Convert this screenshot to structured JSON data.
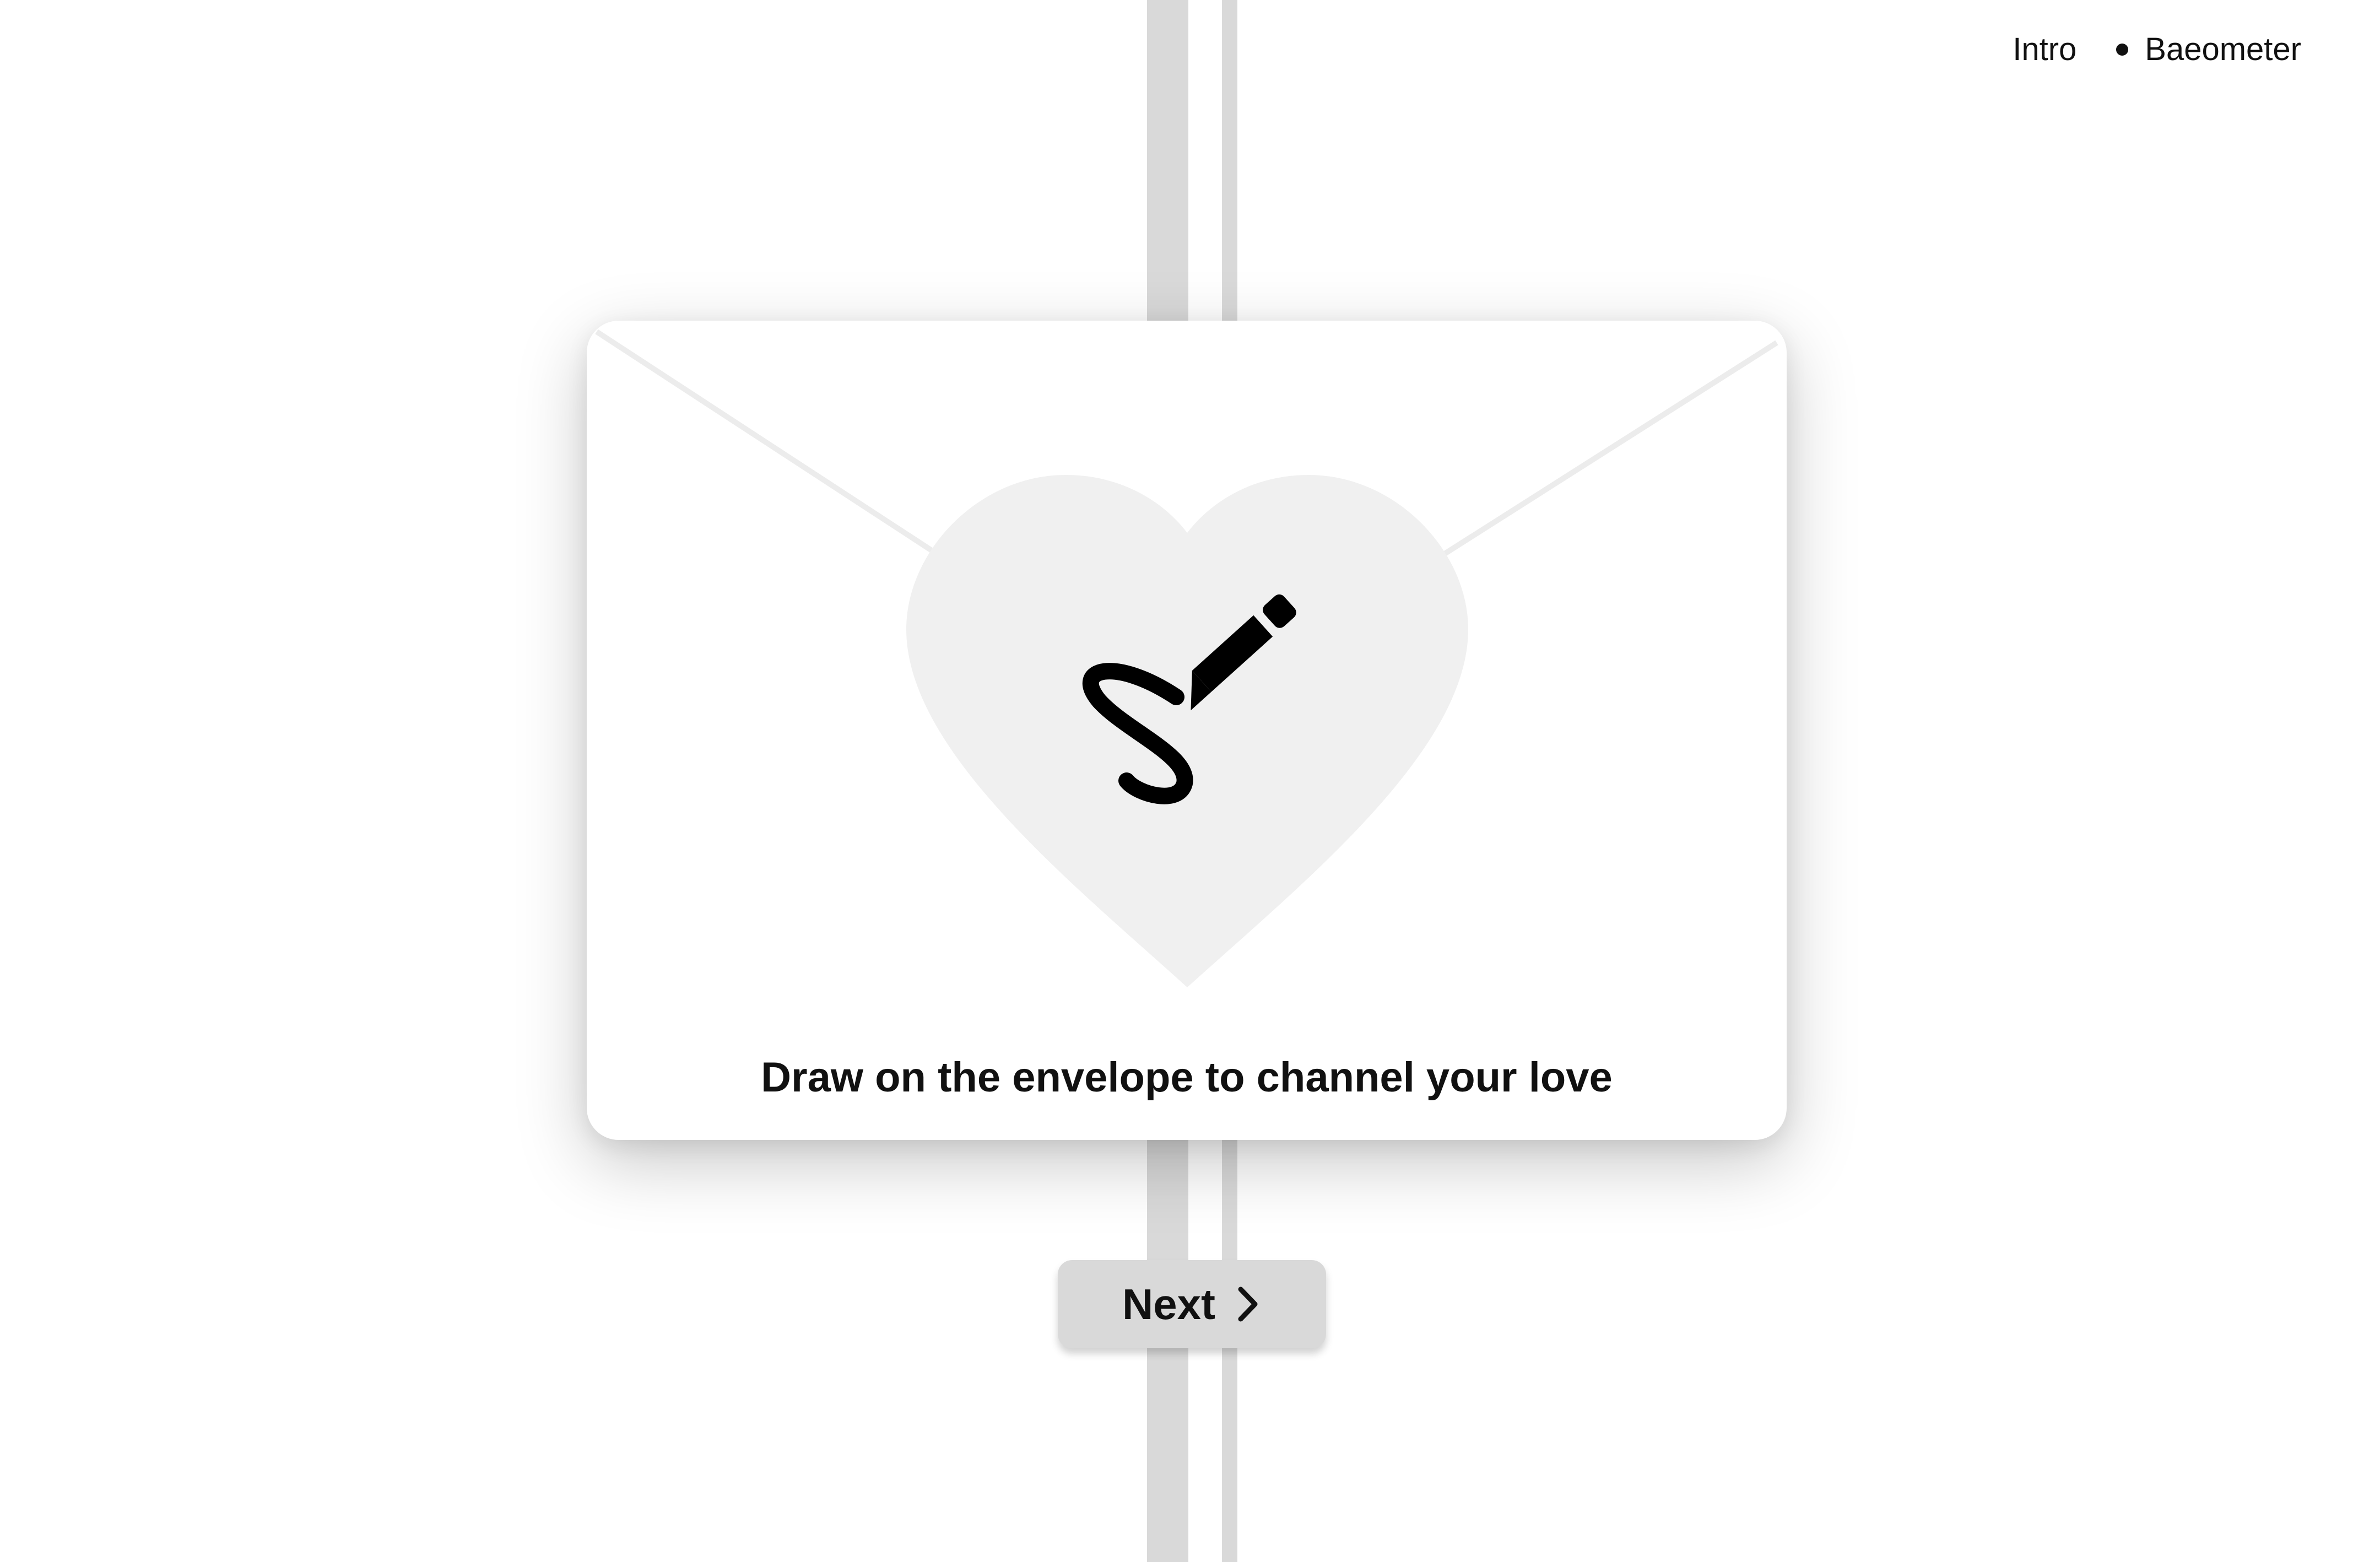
{
  "nav": {
    "items": [
      {
        "label": "Intro"
      },
      {
        "label": "Baeometer"
      }
    ]
  },
  "envelope": {
    "caption": "Draw on the envelope to channel your love",
    "heart_icon": "heart-icon",
    "draw_icon": "signature-pen-icon"
  },
  "next_button": {
    "label": "Next",
    "icon": "chevron-right-icon"
  },
  "colors": {
    "ribbon": "#d9d9d9",
    "heart": "#f0f0f0",
    "text": "#111111",
    "button_bg": "#d9d9d9"
  }
}
